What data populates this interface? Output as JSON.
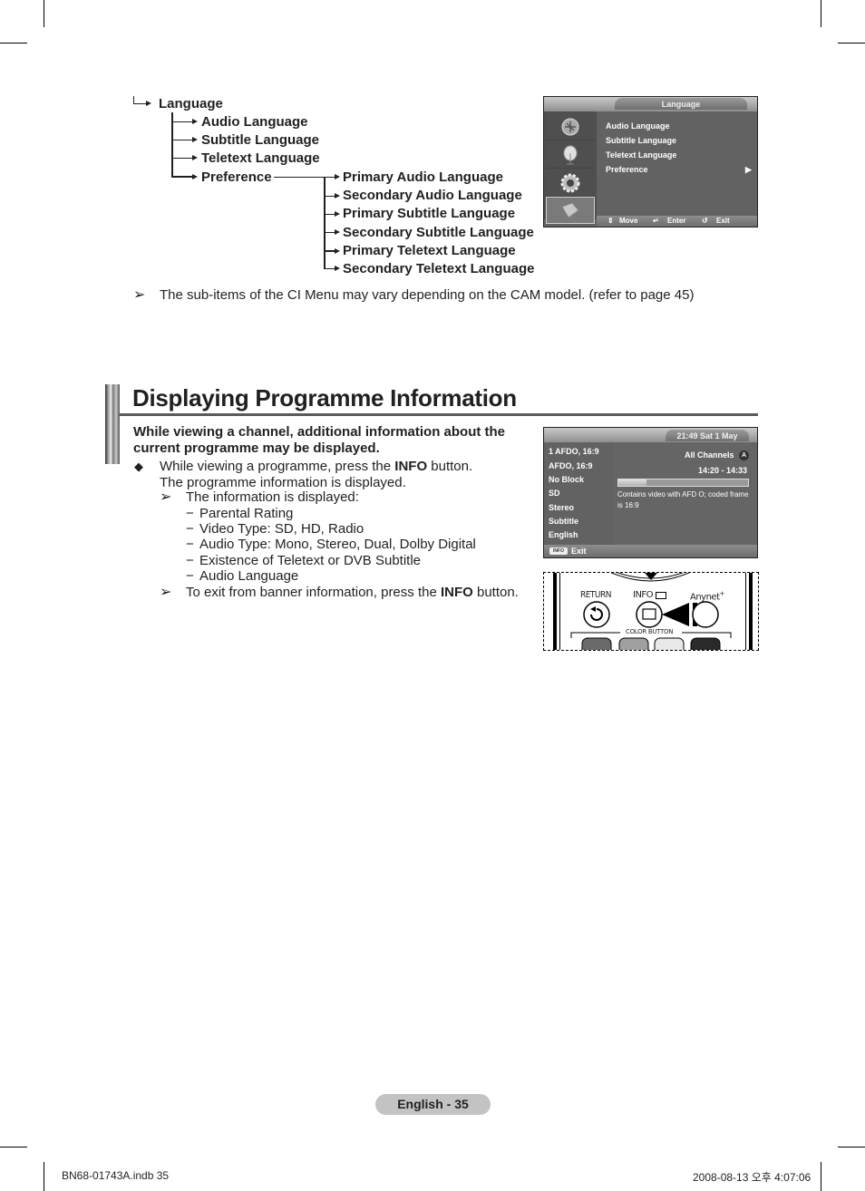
{
  "tree": {
    "root": "Language",
    "children": [
      "Audio Language",
      "Subtitle Language",
      "Teletext Language",
      "Preference"
    ],
    "preference_children": [
      "Primary Audio Language",
      "Secondary Audio Language",
      "Primary Subtitle Language",
      "Secondary Subtitle Language",
      "Primary Teletext Language",
      "Secondary Teletext Language"
    ]
  },
  "language_osd": {
    "title": "Language",
    "items": [
      "Audio Language",
      "Subtitle Language",
      "Teletext Language",
      "Preference"
    ],
    "footer": {
      "move": "Move",
      "enter": "Enter",
      "exit": "Exit"
    },
    "side_icons": [
      "picture-icon",
      "sound-icon",
      "setup-icon",
      "input-icon"
    ]
  },
  "ci_note": "The sub-items of the CI Menu may vary depending on the CAM model. (refer to page 45)",
  "section": {
    "title": "Displaying Programme Information",
    "intro_line1": "While viewing a channel, additional information about the",
    "intro_line2": "current programme may be displayed.",
    "step1_pre": "While viewing a programme, press the ",
    "step1_bold": "INFO",
    "step1_post": " button.",
    "step1_line2": "The programme information is displayed.",
    "note1": "The information is displayed:",
    "info_items": [
      "Parental Rating",
      "Video Type: SD, HD, Radio",
      "Audio Type: Mono, Stereo, Dual, Dolby Digital",
      "Existence of Teletext or DVB Subtitle",
      "Audio Language"
    ],
    "note2_pre": "To exit from banner information, press the ",
    "note2_bold": "INFO",
    "note2_post": " button."
  },
  "info_osd": {
    "datetime": "21:49 Sat 1 May",
    "left_items": [
      "1 AFDO, 16:9",
      "AFDO, 16:9",
      "No Block",
      "SD",
      "Stereo",
      "Subtitle",
      "English"
    ],
    "channel_list": "All Channels",
    "channel_badge": "A",
    "time_range": "14:20 - 14:33",
    "progress": 0.22,
    "description_line1": "Contains video with AFD O; coded frame",
    "description_line2": "is 16:9",
    "footer_key": "INFO",
    "footer_label": "Exit"
  },
  "remote": {
    "return_label": "RETURN",
    "info_label": "INFO",
    "anynet_label": "Anynet",
    "anynet_sup": "+",
    "color_button_label": "COLOR BUTTON",
    "colors": [
      "#6a6a6a",
      "#a0a0a0",
      "#e8e8e8",
      "#2a2a2a"
    ]
  },
  "page_label": "English - 35",
  "footer": {
    "file": "BN68-01743A.indb   35",
    "timestamp": "2008-08-13   오후 4:07:06"
  }
}
